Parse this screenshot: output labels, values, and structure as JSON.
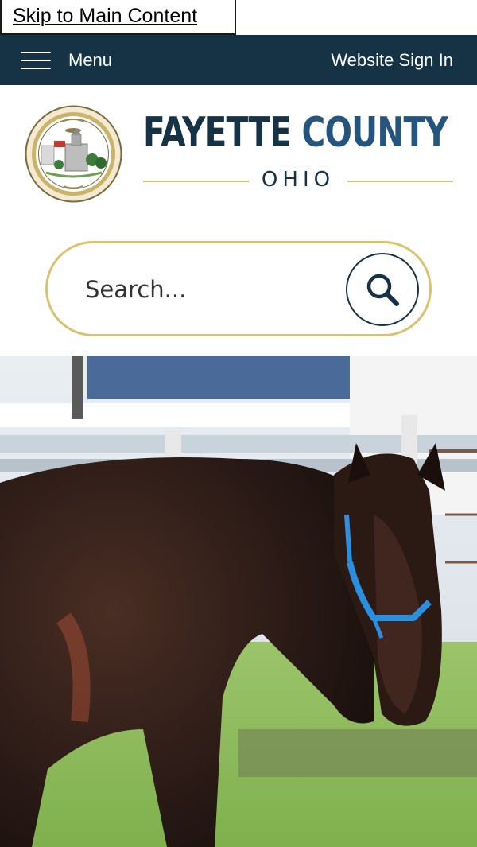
{
  "skip_link": {
    "label": "Skip to Main Content"
  },
  "topbar": {
    "menu_label": "Menu",
    "signin_label": "Website Sign In"
  },
  "brand": {
    "title_word1": "FAYETTE",
    "title_word2": "COUNTY",
    "subtitle": "OHIO"
  },
  "search": {
    "placeholder": "Search...",
    "icon": "search-icon"
  },
  "hero": {
    "alt": "Dark brown horse with a blue halter standing in a paddock"
  },
  "colors": {
    "navy": "#163245",
    "county_blue": "#24557e",
    "gold": "#d8c36f"
  }
}
